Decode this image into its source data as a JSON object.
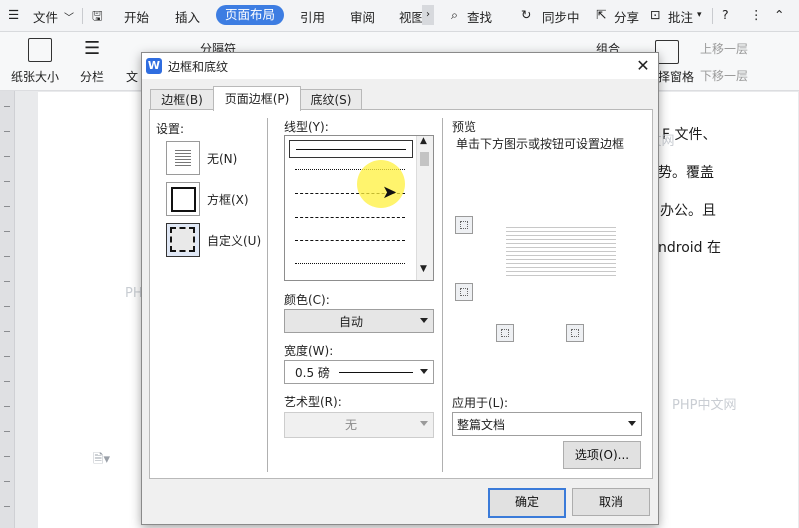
{
  "menubar": {
    "file": "文件",
    "tabs": [
      "开始",
      "插入",
      "页面布局",
      "引用",
      "审阅",
      "视图"
    ],
    "search": "查找",
    "sync": "同步中",
    "share": "分享",
    "annotate": "批注",
    "help": "?",
    "more": "⋮"
  },
  "ribbon": {
    "paper_size": "纸张大小",
    "columns": "分栏",
    "text_dir": "文",
    "separator": "分隔符",
    "group": "组合",
    "select_pane": "择窗格",
    "bring_forward": "上移一层",
    "send_backward": "下移一层"
  },
  "document": {
    "lines": [
      "F 文件、",
      "势。覆盖",
      "办公。且",
      "ndroid 在"
    ],
    "watermarks": [
      "PHP中文网",
      "PHP中文网",
      "PHP中文网",
      "PHP中文网"
    ]
  },
  "dialog": {
    "title": "边框和底纹",
    "close": "✕",
    "tabs": [
      "边框(B)",
      "页面边框(P)",
      "底纹(S)"
    ],
    "settings_label": "设置:",
    "settings": [
      "无(N)",
      "方框(X)",
      "自定义(U)"
    ],
    "line_style_label": "线型(Y):",
    "color_label": "颜色(C):",
    "color_value": "自动",
    "width_label": "宽度(W):",
    "width_value": "0.5 磅",
    "art_label": "艺术型(R):",
    "art_value": "无",
    "preview_label": "预览",
    "preview_hint": "单击下方图示或按钮可设置边框",
    "apply_label": "应用于(L):",
    "apply_value": "整篇文档",
    "options_button": "选项(O)...",
    "ok_button": "确定",
    "cancel_button": "取消"
  },
  "colors": {
    "accent": "#3d7de2"
  }
}
